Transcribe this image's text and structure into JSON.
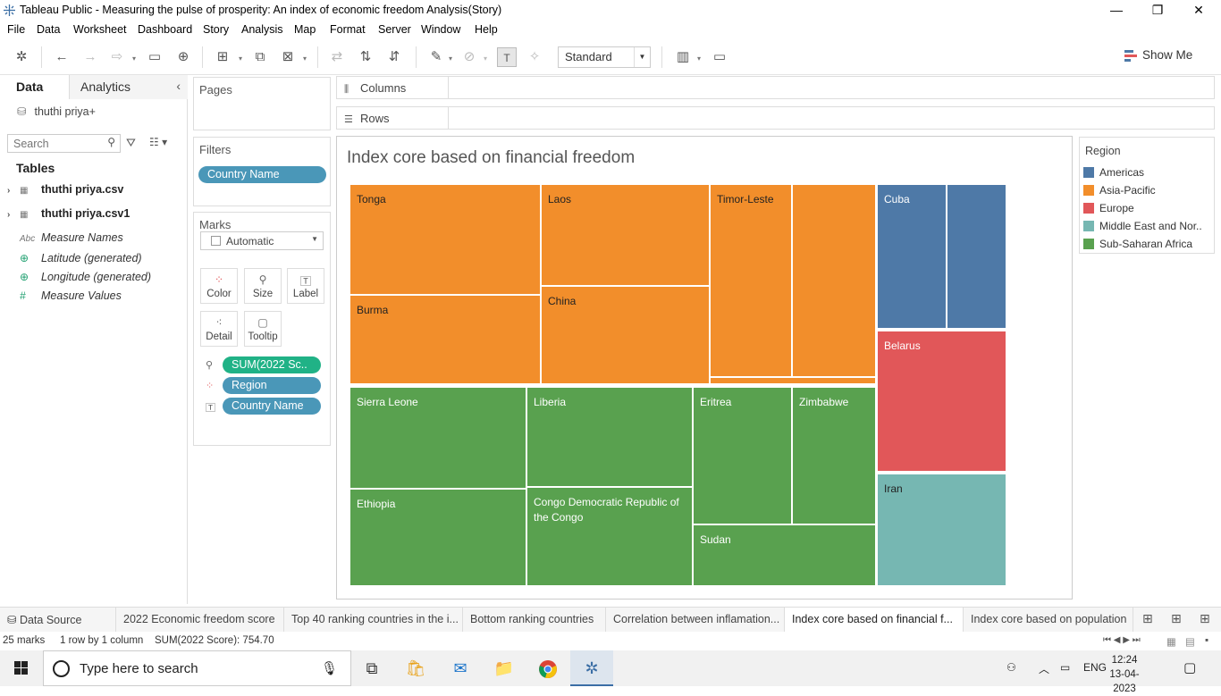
{
  "window": {
    "title": "Tableau Public - Measuring the pulse of prosperity: An index of economic freedom Analysis(Story)",
    "minimize": "—",
    "restore": "❐",
    "close": "✕"
  },
  "menu": [
    "File",
    "Data",
    "Worksheet",
    "Dashboard",
    "Story",
    "Analysis",
    "Map",
    "Format",
    "Server",
    "Window",
    "Help"
  ],
  "toolbar": {
    "fit_value": "Standard",
    "show_me_label": "Show Me"
  },
  "data_pane": {
    "tab_data": "Data",
    "tab_analytics": "Analytics",
    "datasource": "thuthi priya+",
    "search_placeholder": "Search",
    "tables_title": "Tables",
    "tables": [
      "thuthi priya.csv",
      "thuthi priya.csv1"
    ],
    "fields": [
      {
        "icon": "Abc",
        "name": "Measure Names"
      },
      {
        "icon": "⊕",
        "name": "Latitude (generated)"
      },
      {
        "icon": "⊕",
        "name": "Longitude (generated)"
      },
      {
        "icon": "#",
        "name": "Measure Values"
      }
    ]
  },
  "pages_title": "Pages",
  "filters": {
    "title": "Filters",
    "pills": [
      "Country Name"
    ]
  },
  "marks": {
    "title": "Marks",
    "type": "Automatic",
    "buttons": [
      "Color",
      "Size",
      "Label",
      "Detail",
      "Tooltip"
    ],
    "pills": [
      "SUM(2022 Sc..",
      "Region",
      "Country Name"
    ]
  },
  "shelves": {
    "columns": "Columns",
    "rows": "Rows"
  },
  "view": {
    "title": "Index core based on financial freedom"
  },
  "legend": {
    "title": "Region",
    "items": [
      {
        "label": "Americas",
        "color": "#4e79a7"
      },
      {
        "label": "Asia-Pacific",
        "color": "#f28e2b"
      },
      {
        "label": "Europe",
        "color": "#e15759"
      },
      {
        "label": "Middle East and Nor..",
        "color": "#76b7b2"
      },
      {
        "label": "Sub-Saharan Africa",
        "color": "#59a14f"
      }
    ]
  },
  "treemap_labels": {
    "tonga": "Tonga",
    "laos": "Laos",
    "timor": "Timor-Leste",
    "cuba": "Cuba",
    "burma": "Burma",
    "china": "China",
    "belarus": "Belarus",
    "sierra": "Sierra Leone",
    "liberia": "Liberia",
    "eritrea": "Eritrea",
    "zimbabwe": "Zimbabwe",
    "ethiopia": "Ethiopia",
    "congo": "Congo Democratic Republic of the Congo",
    "sudan": "Sudan",
    "iran": "Iran"
  },
  "sheet_tabs": [
    "Data Source",
    "2022 Economic freedom score",
    "Top 40 ranking countries in the i...",
    "Bottom ranking countries",
    "Correlation between inflamation...",
    "Index core based on financial f...",
    "Index core based on population"
  ],
  "status": {
    "marks": "25 marks",
    "rows_cols": "1 row by 1 column",
    "sum": "SUM(2022 Score): 754.70"
  },
  "taskbar": {
    "search_placeholder": "Type here to search",
    "lang": "ENG",
    "time": "12:24",
    "date": "13-04-2023"
  }
}
